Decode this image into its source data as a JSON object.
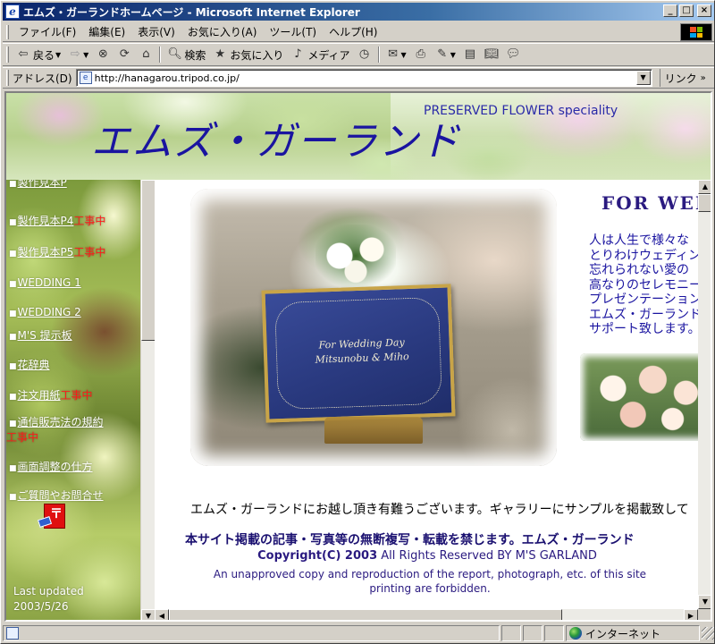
{
  "window": {
    "title": "エムズ・ガーランドホームページ - Microsoft Internet Explorer",
    "min_label": "_",
    "max_label": "□",
    "close_label": "×"
  },
  "menu": [
    "ファイル(F)",
    "編集(E)",
    "表示(V)",
    "お気に入り(A)",
    "ツール(T)",
    "ヘルプ(H)"
  ],
  "toolbar": {
    "back": "戻る",
    "search": "検索",
    "favorites": "お気に入り",
    "media": "メディア"
  },
  "address": {
    "label": "アドレス(D)",
    "url": "http://hanagarou.tripod.co.jp/",
    "links": "リンク"
  },
  "banner": {
    "title": "エムズ・ガーランド",
    "tagline": "PRESERVED FLOWER speciality"
  },
  "nav": {
    "items": [
      {
        "text": "製作見本P",
        "wip": ""
      },
      {
        "text": "製作見本P4",
        "wip": "工事中"
      },
      {
        "text": "製作見本P5",
        "wip": "工事中"
      },
      {
        "text": "WEDDING 1",
        "wip": ""
      },
      {
        "text": "WEDDING 2",
        "wip": ""
      },
      {
        "text": "M'S 提示板",
        "wip": ""
      },
      {
        "text": "花辞典",
        "wip": ""
      },
      {
        "text": "注文用紙",
        "wip": "工事中"
      },
      {
        "text": "通信販売法の規約",
        "wip": "工事中"
      },
      {
        "text": "画面調整の仕方",
        "wip": ""
      },
      {
        "text": "ご質問やお問合せ",
        "wip": ""
      }
    ],
    "last_updated_label": "Last updated",
    "last_updated_date": "2003/5/26"
  },
  "main": {
    "heading": "FOR WEDDING",
    "intro_lines": [
      "人は人生で様々な",
      "とりわけウェディン",
      "忘れられない愛の",
      "高なりのセレモニー",
      "プレゼンテーション",
      "エムズ・ガーランド",
      "サポート致します。"
    ],
    "board_line1": "For Wedding Day",
    "board_line2": "Mitsunobu & Miho",
    "welcome": "エムズ・ガーランドにお越し頂き有難うございます。ギャラリーにサンプルを掲載致して",
    "notice": "本サイト掲載の記事・写真等の無断複写・転載を禁じます。エムズ・ガーランド",
    "copyright_bold": "Copyright(C) 2003",
    "copyright_rest": " All Rights Reserved  BY  M'S  GARLAND",
    "english_line1": "An unapproved copy and reproduction of the report, photograph, etc. of this site",
    "english_line2": "printing are forbidden."
  },
  "status": {
    "zone": "インターネット"
  }
}
